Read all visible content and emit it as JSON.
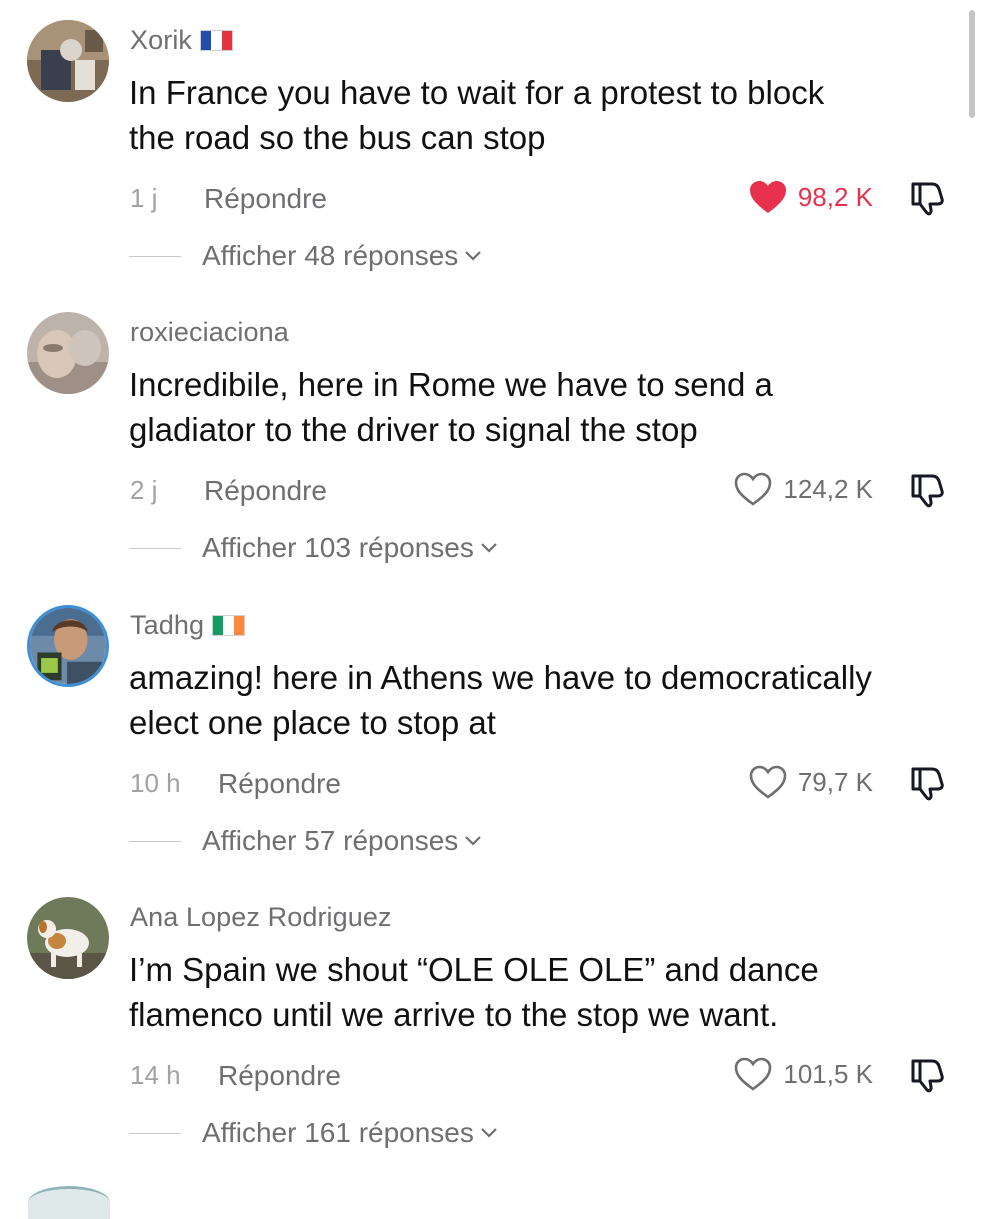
{
  "comments": [
    {
      "username": "Xorik",
      "flag": "france",
      "text_line1": "In France you have to wait for a protest to block",
      "text_line2": "the road so the bus can stop",
      "time": "1 j",
      "reply_label": "Répondre",
      "likes": "98,2 K",
      "liked": true,
      "replies_label": "Afficher 48 réponses"
    },
    {
      "username": "roxieciaciona",
      "flag": "",
      "text_line1": "Incredibile, here in Rome we have to send a",
      "text_line2": "gladiator to the driver to signal the stop",
      "time": "2 j",
      "reply_label": "Répondre",
      "likes": "124,2 K",
      "liked": false,
      "replies_label": "Afficher 103 réponses"
    },
    {
      "username": "Tadhg",
      "flag": "ireland",
      "text_line1": "amazing! here in Athens we have to democratically",
      "text_line2": "elect one place to stop at",
      "time": "10 h",
      "reply_label": "Répondre",
      "likes": "79,7 K",
      "liked": false,
      "replies_label": "Afficher 57 réponses"
    },
    {
      "username": "Ana Lopez Rodriguez",
      "flag": "",
      "text_line1": "I’m Spain we shout “OLE OLE OLE” and dance",
      "text_line2": "flamenco until we arrive to the stop we want.",
      "time": "14 h",
      "reply_label": "Répondre",
      "likes": "101,5 K",
      "liked": false,
      "replies_label": "Afficher 161 réponses"
    }
  ],
  "colors": {
    "like_active": "#e8304f",
    "meta_text": "#6e6e73",
    "time_text": "#a1a1a6",
    "body_text": "#111111"
  },
  "icons": {
    "like": "heart-icon",
    "dislike": "thumbs-down-icon",
    "expand": "chevron-down-icon"
  }
}
